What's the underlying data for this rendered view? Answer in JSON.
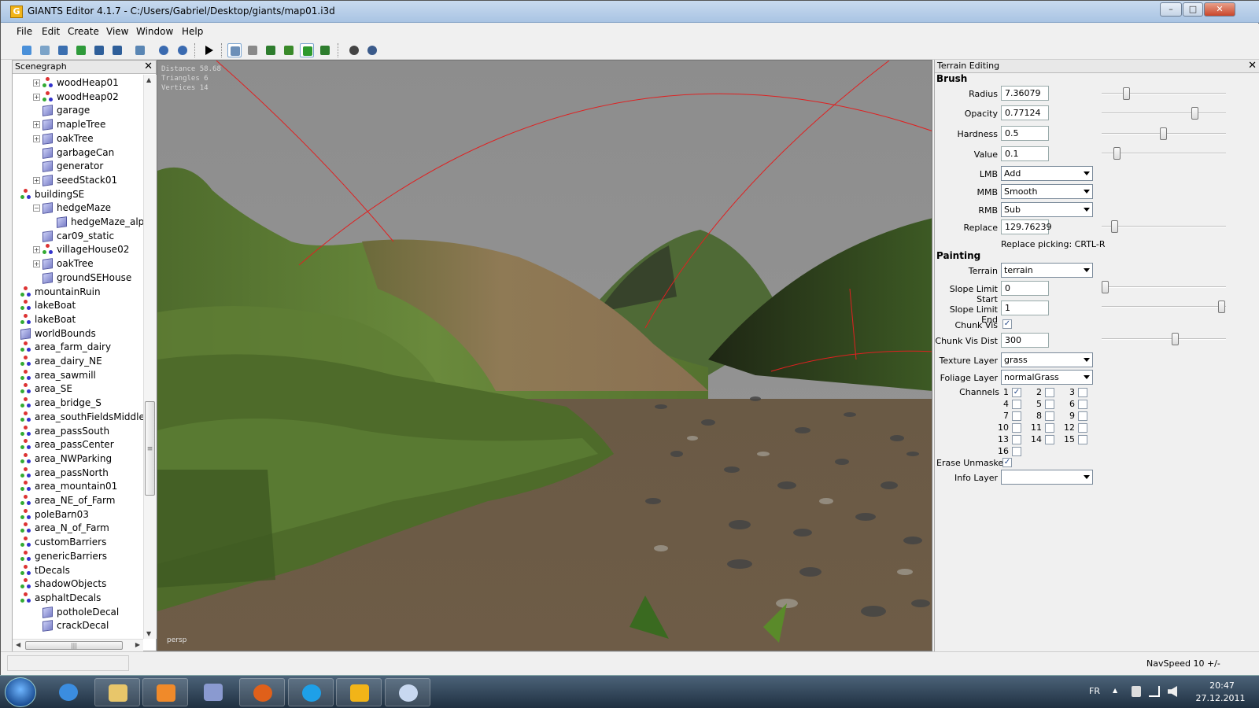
{
  "window": {
    "title": "GIANTS Editor 4.1.7 - C:/Users/Gabriel/Desktop/giants/map01.i3d",
    "controls": {
      "minimize": "–",
      "maximize": "□",
      "close": "✕"
    }
  },
  "menu": [
    "File",
    "Edit",
    "Create",
    "View",
    "Window",
    "Help"
  ],
  "toolbar_icons": [
    "new-icon",
    "open-icon",
    "list-icon",
    "refresh-icon",
    "save-icon",
    "save-all-icon",
    "import-icon",
    "undo-icon",
    "redo-icon",
    "play-icon",
    "select-icon",
    "magnet-icon",
    "terrain-sculpt-icon",
    "terrain-paint-icon",
    "foliage-paint-icon",
    "info-layer-icon",
    "particle-icon",
    "settings-icon"
  ],
  "scenegraph": {
    "title": "Scenegraph",
    "close": "✕",
    "items": [
      {
        "label": "woodHeap01",
        "level": 1,
        "icon": "group",
        "expand": "+"
      },
      {
        "label": "woodHeap02",
        "level": 1,
        "icon": "group",
        "expand": "+"
      },
      {
        "label": "garage",
        "level": 1,
        "icon": "cube",
        "expand": ""
      },
      {
        "label": "mapleTree",
        "level": 1,
        "icon": "cube",
        "expand": "+"
      },
      {
        "label": "oakTree",
        "level": 1,
        "icon": "cube",
        "expand": "+"
      },
      {
        "label": "garbageCan",
        "level": 1,
        "icon": "cube",
        "expand": ""
      },
      {
        "label": "generator",
        "level": 1,
        "icon": "cube",
        "expand": ""
      },
      {
        "label": "seedStack01",
        "level": 1,
        "icon": "cube",
        "expand": "+"
      },
      {
        "label": "buildingSE",
        "level": 0,
        "icon": "group",
        "expand": ""
      },
      {
        "label": "hedgeMaze",
        "level": 1,
        "icon": "cube",
        "expand": "−"
      },
      {
        "label": "hedgeMaze_alpha",
        "level": 2,
        "icon": "cube",
        "expand": ""
      },
      {
        "label": "car09_static",
        "level": 1,
        "icon": "cube",
        "expand": ""
      },
      {
        "label": "villageHouse02",
        "level": 1,
        "icon": "group",
        "expand": "+"
      },
      {
        "label": "oakTree",
        "level": 1,
        "icon": "cube",
        "expand": "+"
      },
      {
        "label": "groundSEHouse",
        "level": 1,
        "icon": "cube",
        "expand": ""
      },
      {
        "label": "mountainRuin",
        "level": 0,
        "icon": "group",
        "expand": ""
      },
      {
        "label": "lakeBoat",
        "level": 0,
        "icon": "group",
        "expand": ""
      },
      {
        "label": "lakeBoat",
        "level": 0,
        "icon": "group",
        "expand": ""
      },
      {
        "label": "worldBounds",
        "level": 0,
        "icon": "cube",
        "expand": ""
      },
      {
        "label": "area_farm_dairy",
        "level": 0,
        "icon": "group",
        "expand": ""
      },
      {
        "label": "area_dairy_NE",
        "level": 0,
        "icon": "group",
        "expand": ""
      },
      {
        "label": "area_sawmill",
        "level": 0,
        "icon": "group",
        "expand": ""
      },
      {
        "label": "area_SE",
        "level": 0,
        "icon": "group",
        "expand": ""
      },
      {
        "label": "area_bridge_S",
        "level": 0,
        "icon": "group",
        "expand": ""
      },
      {
        "label": "area_southFieldsMiddle",
        "level": 0,
        "icon": "group",
        "expand": ""
      },
      {
        "label": "area_passSouth",
        "level": 0,
        "icon": "group",
        "expand": ""
      },
      {
        "label": "area_passCenter",
        "level": 0,
        "icon": "group",
        "expand": ""
      },
      {
        "label": "area_NWParking",
        "level": 0,
        "icon": "group",
        "expand": ""
      },
      {
        "label": "area_passNorth",
        "level": 0,
        "icon": "group",
        "expand": ""
      },
      {
        "label": "area_mountain01",
        "level": 0,
        "icon": "group",
        "expand": ""
      },
      {
        "label": "area_NE_of_Farm",
        "level": 0,
        "icon": "group",
        "expand": ""
      },
      {
        "label": "poleBarn03",
        "level": 0,
        "icon": "group",
        "expand": ""
      },
      {
        "label": "area_N_of_Farm",
        "level": 0,
        "icon": "group",
        "expand": ""
      },
      {
        "label": "customBarriers",
        "level": 0,
        "icon": "group",
        "expand": ""
      },
      {
        "label": "genericBarriers",
        "level": 0,
        "icon": "group",
        "expand": ""
      },
      {
        "label": "tDecals",
        "level": 0,
        "icon": "group",
        "expand": ""
      },
      {
        "label": "shadowObjects",
        "level": 0,
        "icon": "group",
        "expand": ""
      },
      {
        "label": "asphaltDecals",
        "level": 0,
        "icon": "group",
        "expand": ""
      },
      {
        "label": "potholeDecal",
        "level": 1,
        "icon": "cube",
        "expand": ""
      },
      {
        "label": "crackDecal",
        "level": 1,
        "icon": "cube",
        "expand": ""
      }
    ],
    "scroll": {
      "up": "▲",
      "down": "▼",
      "left": "◀",
      "right": "▶",
      "grip": "|||",
      "vgrip": "≡"
    }
  },
  "viewport": {
    "stats": [
      "Distance 58.68",
      "Triangles 6",
      "Vertices 14"
    ],
    "camera": "persp"
  },
  "terrain": {
    "title": "Terrain Editing",
    "close": "✕",
    "brush_heading": "Brush",
    "radius": {
      "label": "Radius",
      "value": "7.36079",
      "slider": 0.18
    },
    "opacity": {
      "label": "Opacity",
      "value": "0.77124",
      "slider": 0.77
    },
    "hardness": {
      "label": "Hardness",
      "value": "0.5",
      "slider": 0.5
    },
    "value": {
      "label": "Value",
      "value": "0.1",
      "slider": 0.1
    },
    "lmb": {
      "label": "LMB",
      "value": "Add"
    },
    "mmb": {
      "label": "MMB",
      "value": "Smooth"
    },
    "rmb": {
      "label": "RMB",
      "value": "Sub"
    },
    "replace": {
      "label": "Replace",
      "value": "129.76239",
      "slider": 0.08
    },
    "replace_picking": "Replace picking: CRTL-R",
    "painting_heading": "Painting",
    "terrain_sel": {
      "label": "Terrain",
      "value": "terrain"
    },
    "slope_start": {
      "label": "Slope Limit Start",
      "value": "0",
      "slider": 0.0
    },
    "slope_end": {
      "label": "Slope Limit End",
      "value": "1",
      "slider": 1.0
    },
    "chunk_vis": {
      "label": "Chunk Vis",
      "checked": "✓"
    },
    "chunk_vis_dist": {
      "label": "Chunk Vis Dist",
      "value": "300",
      "slider": 0.6
    },
    "texture_layer": {
      "label": "Texture Layer",
      "value": "grass"
    },
    "foliage_layer": {
      "label": "Foliage Layer",
      "value": "normalGrass"
    },
    "channels_label": "Channels",
    "channels": [
      {
        "n": "1",
        "checked": "✓"
      },
      {
        "n": "2",
        "checked": ""
      },
      {
        "n": "3",
        "checked": ""
      },
      {
        "n": "4",
        "checked": ""
      },
      {
        "n": "5",
        "checked": ""
      },
      {
        "n": "6",
        "checked": ""
      },
      {
        "n": "7",
        "checked": ""
      },
      {
        "n": "8",
        "checked": ""
      },
      {
        "n": "9",
        "checked": ""
      },
      {
        "n": "10",
        "checked": ""
      },
      {
        "n": "11",
        "checked": ""
      },
      {
        "n": "12",
        "checked": ""
      },
      {
        "n": "13",
        "checked": ""
      },
      {
        "n": "14",
        "checked": ""
      },
      {
        "n": "15",
        "checked": ""
      },
      {
        "n": "16",
        "checked": ""
      }
    ],
    "erase_unmasked": {
      "label": "Erase Unmasked",
      "checked": "✓"
    },
    "info_layer": {
      "label": "Info Layer",
      "value": ""
    }
  },
  "status": {
    "nav_speed": "NavSpeed 10 +/-"
  },
  "taskbar": {
    "apps": [
      "internet-explorer-icon",
      "file-explorer-icon",
      "media-player-icon",
      "paint-tool-icon",
      "firefox-icon",
      "skype-icon",
      "giants-editor-icon",
      "paint-icon"
    ],
    "lang": "FR",
    "tray": "▲",
    "time": "20:47",
    "date": "27.12.2011"
  }
}
